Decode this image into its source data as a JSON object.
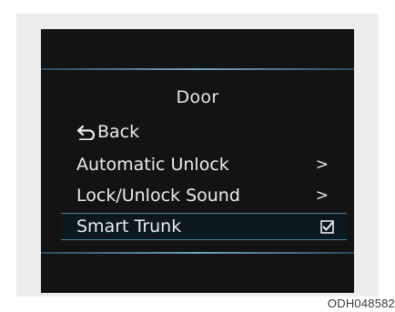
{
  "screen": {
    "title": "Door",
    "back": {
      "icon": "back-arrow-icon",
      "label": "Back"
    },
    "items": [
      {
        "label": "Automatic Unlock",
        "indicator": ">",
        "indicator_icon": "chevron-right-icon"
      },
      {
        "label": "Lock/Unlock Sound",
        "indicator": ">",
        "indicator_icon": "chevron-right-icon"
      },
      {
        "label": "Smart Trunk",
        "indicator_icon": "checkbox-checked-icon",
        "checked": true,
        "selected": true
      }
    ]
  },
  "figure_code": "ODH048582",
  "colors": {
    "screen_bg": "#131313",
    "text": "#ececec",
    "accent_line": "#6fa3bf",
    "selected_bg": "#0b1820"
  }
}
